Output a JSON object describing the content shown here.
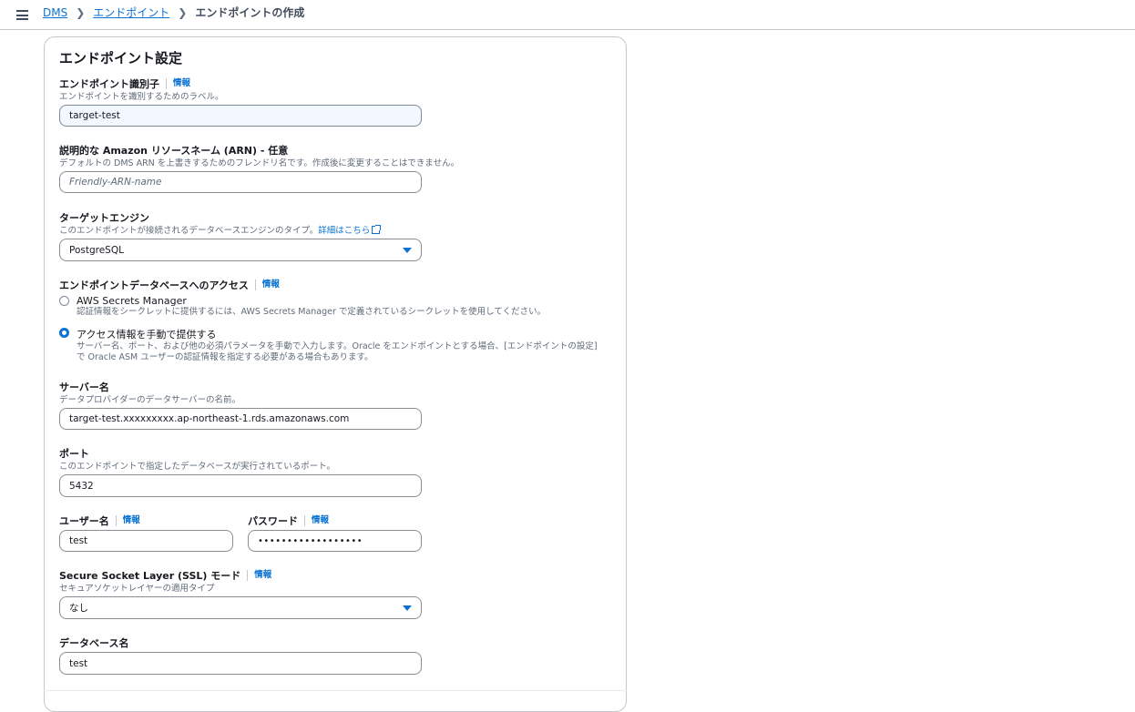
{
  "breadcrumb": {
    "items": [
      "DMS",
      "エンドポイント"
    ],
    "current": "エンドポイントの作成"
  },
  "panel": {
    "title": "エンドポイント設定"
  },
  "fields": {
    "identifier": {
      "label": "エンドポイント識別子",
      "info": "情報",
      "desc": "エンドポイントを識別するためのラベル。",
      "value": "target-test"
    },
    "arn": {
      "label": "説明的な Amazon リソースネーム (ARN) - 任意",
      "desc": "デフォルトの DMS ARN を上書きするためのフレンドリ名です。作成後に変更することはできません。",
      "placeholder": "Friendly-ARN-name"
    },
    "engine": {
      "label": "ターゲットエンジン",
      "desc": "このエンドポイントが接続されるデータベースエンジンのタイプ。",
      "link": "詳細はこちら",
      "value": "PostgreSQL"
    },
    "access": {
      "label": "エンドポイントデータベースへのアクセス",
      "info": "情報",
      "options": [
        {
          "label": "AWS Secrets Manager",
          "desc": "認証情報をシークレットに提供するには、AWS Secrets Manager で定義されているシークレットを使用してください。",
          "checked": false
        },
        {
          "label": "アクセス情報を手動で提供する",
          "desc_line1": "サーバー名、ポート、および他の必須パラメータを手動で入力します。Oracle をエンドポイントとする場合、[エンドポイントの設定]",
          "desc_line2": "で Oracle ASM ユーザーの認証情報を指定する必要がある場合もあります。",
          "checked": true
        }
      ]
    },
    "server": {
      "label": "サーバー名",
      "desc": "データプロバイダーのデータサーバーの名前。",
      "value": "target-test.xxxxxxxxx.ap-northeast-1.rds.amazonaws.com"
    },
    "port": {
      "label": "ポート",
      "desc": "このエンドポイントで指定したデータベースが実行されているポート。",
      "value": "5432"
    },
    "username": {
      "label": "ユーザー名",
      "info": "情報",
      "value": "test"
    },
    "password": {
      "label": "パスワード",
      "info": "情報",
      "value": "••••••••••••••••••"
    },
    "ssl": {
      "label": "Secure Socket Layer (SSL) モード",
      "info": "情報",
      "desc": "セキュアソケットレイヤーの適用タイプ",
      "value": "なし"
    },
    "dbname": {
      "label": "データベース名",
      "value": "test"
    }
  },
  "colors": {
    "link": "#0972d3",
    "border": "#8c8c94",
    "focused_bg": "#f2f8fd"
  }
}
